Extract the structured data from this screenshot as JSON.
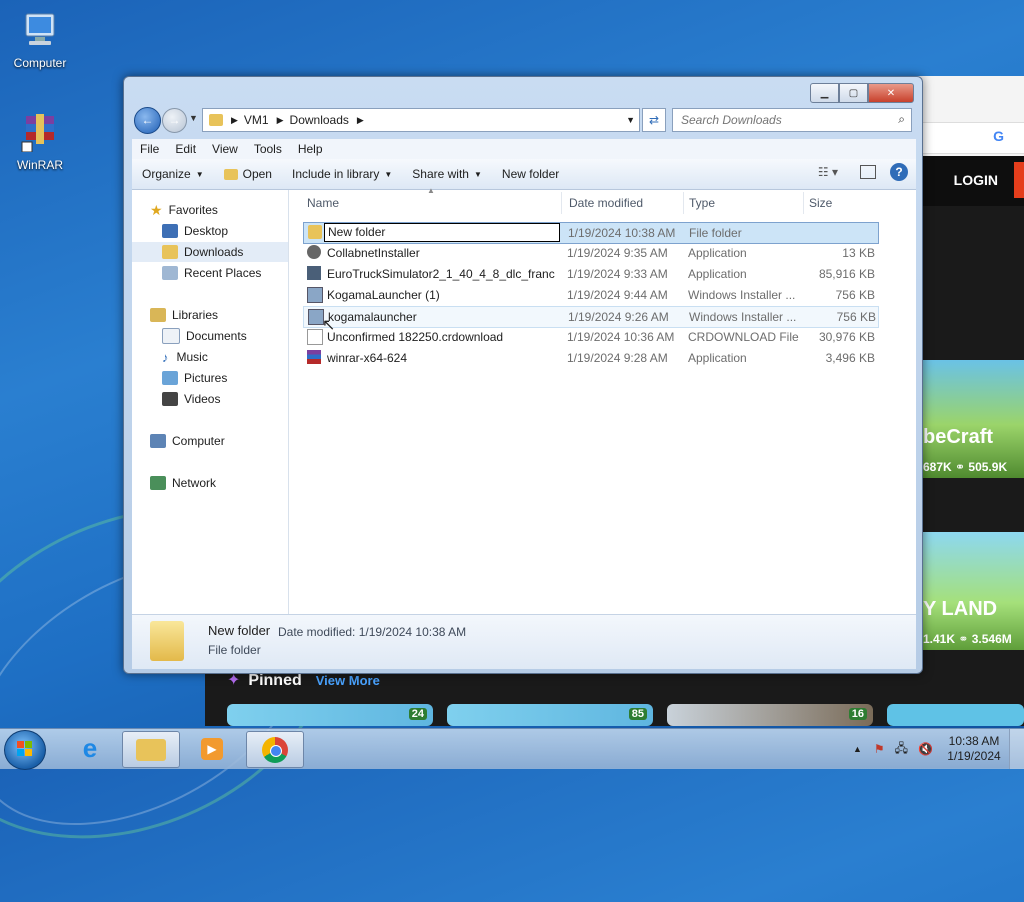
{
  "desktop": {
    "icons": [
      {
        "label": "Computer",
        "icon": "computer-icon"
      },
      {
        "label": "WinRAR",
        "icon": "winrar-icon"
      }
    ]
  },
  "browser": {
    "search_g": "G",
    "login": "LOGIN",
    "card1": {
      "title": "beCraft",
      "stats": "687K  ⚭ 505.9K"
    },
    "card2": {
      "title": "Y LAND",
      "stats": "1.41K  ⚭ 3.546M"
    },
    "pinned": "Pinned",
    "view_more": "View More",
    "pinned_counts": [
      "24",
      "85",
      "16"
    ]
  },
  "explorer": {
    "address": {
      "root": "VM1",
      "folder": "Downloads"
    },
    "search_placeholder": "Search Downloads",
    "menu": [
      "File",
      "Edit",
      "View",
      "Tools",
      "Help"
    ],
    "toolbar": {
      "organize": "Organize",
      "open": "Open",
      "include": "Include in library",
      "share": "Share with",
      "new_folder": "New folder"
    },
    "nav": {
      "favorites": "Favorites",
      "desktop": "Desktop",
      "downloads": "Downloads",
      "recent": "Recent Places",
      "libraries": "Libraries",
      "documents": "Documents",
      "music": "Music",
      "pictures": "Pictures",
      "videos": "Videos",
      "computer": "Computer",
      "network": "Network"
    },
    "columns": {
      "name": "Name",
      "date": "Date modified",
      "type": "Type",
      "size": "Size"
    },
    "files": [
      {
        "name": "New folder",
        "date": "1/19/2024 10:38 AM",
        "type": "File folder",
        "size": ""
      },
      {
        "name": "CollabnetInstaller",
        "date": "1/19/2024 9:35 AM",
        "type": "Application",
        "size": "13 KB"
      },
      {
        "name": "EuroTruckSimulator2_1_40_4_8_dlc_franc...",
        "date": "1/19/2024 9:33 AM",
        "type": "Application",
        "size": "85,916 KB"
      },
      {
        "name": "KogamaLauncher (1)",
        "date": "1/19/2024 9:44 AM",
        "type": "Windows Installer ...",
        "size": "756 KB"
      },
      {
        "name": "kogamalauncher",
        "date": "1/19/2024 9:26 AM",
        "type": "Windows Installer ...",
        "size": "756 KB"
      },
      {
        "name": "Unconfirmed 182250.crdownload",
        "date": "1/19/2024 10:36 AM",
        "type": "CRDOWNLOAD File",
        "size": "30,976 KB"
      },
      {
        "name": "winrar-x64-624",
        "date": "1/19/2024 9:28 AM",
        "type": "Application",
        "size": "3,496 KB"
      }
    ],
    "details": {
      "name": "New folder",
      "date_label": "Date modified: 1/19/2024 10:38 AM",
      "type": "File folder"
    }
  },
  "taskbar": {
    "time": "10:38 AM",
    "date": "1/19/2024"
  },
  "colors": {
    "accent": "#2f6cb8",
    "selection": "#cce4f7",
    "login_bar": "#e53e1c"
  }
}
